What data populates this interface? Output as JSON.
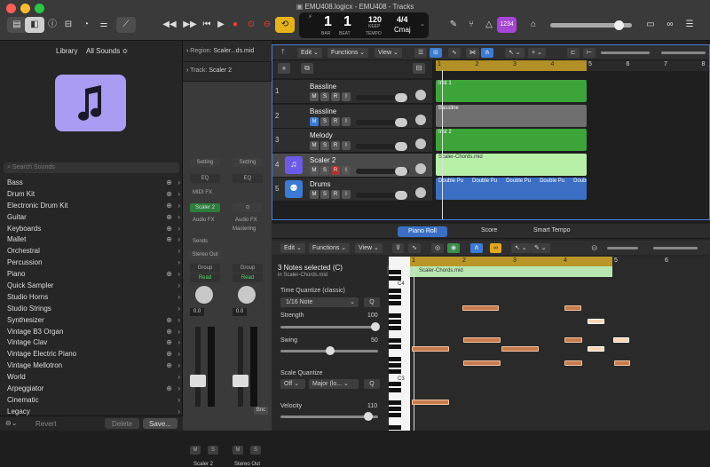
{
  "window": {
    "title": "EMU408.logicx - EMU408 - Tracks"
  },
  "lcd": {
    "bar": "1",
    "beat": "1",
    "bar_label": "BAR",
    "beat_label": "BEAT",
    "tempo": "120",
    "tempo_mode": "KEEP",
    "tempo_label": "TEMPO",
    "time_sig": "4/4",
    "key": "Cmaj"
  },
  "toolbar": {
    "count_in": "1234"
  },
  "library": {
    "title": "Library",
    "filter": "All Sounds ≎",
    "search_placeholder": "Search Sounds",
    "revert": "Revert",
    "delete": "Delete",
    "save": "Save...",
    "items": [
      {
        "label": "Bass",
        "plus": true
      },
      {
        "label": "Drum Kit",
        "plus": true
      },
      {
        "label": "Electronic Drum Kit",
        "plus": true
      },
      {
        "label": "Guitar",
        "plus": true
      },
      {
        "label": "Keyboards",
        "plus": true
      },
      {
        "label": "Mallet",
        "plus": true
      },
      {
        "label": "Orchestral",
        "plus": false
      },
      {
        "label": "Percussion",
        "plus": false
      },
      {
        "label": "Piano",
        "plus": true
      },
      {
        "label": "Quick Sampler",
        "plus": false
      },
      {
        "label": "Studio Horns",
        "plus": false
      },
      {
        "label": "Studio Strings",
        "plus": false
      },
      {
        "label": "Synthesizer",
        "plus": true
      },
      {
        "label": "Vintage B3 Organ",
        "plus": true
      },
      {
        "label": "Vintage Clav",
        "plus": true
      },
      {
        "label": "Vintage Electric Piano",
        "plus": true
      },
      {
        "label": "Vintage Mellotron",
        "plus": true
      },
      {
        "label": "World",
        "plus": false
      },
      {
        "label": "Arpeggiator",
        "plus": true
      },
      {
        "label": "Cinematic",
        "plus": false
      },
      {
        "label": "Legacy",
        "plus": false
      }
    ]
  },
  "inspector": {
    "region": "Region:",
    "region_name": "Scaler...ds.mid",
    "track": "Track:",
    "track_name": "Scaler 2",
    "setting": "Setting",
    "eq": "EQ",
    "midi_fx": "MIDI FX",
    "plugin": "Scaler 2",
    "audio_fx": "Audio FX",
    "audio_fx_mastering": "Mastering",
    "sends": "Sends",
    "stereo_out": "Stereo Out",
    "group": "Group",
    "read": "Read",
    "vol": "0.0",
    "m": "M",
    "s": "S",
    "bnc": "Bnc",
    "strip1": "Scaler 2",
    "strip2": "Stereo Out"
  },
  "tracks_menu": {
    "edit": "Edit",
    "functions": "Functions",
    "view": "View"
  },
  "ruler": [
    "1",
    "2",
    "3",
    "4",
    "5",
    "6",
    "7",
    "8"
  ],
  "tracks": [
    {
      "num": "1",
      "name": "Bassline",
      "region": "Inst 1"
    },
    {
      "num": "2",
      "name": "Bassline",
      "region": "Bassline"
    },
    {
      "num": "3",
      "name": "Melody",
      "region": "Inst 2"
    },
    {
      "num": "4",
      "name": "Scaler 2",
      "region": "Scaler-Chords.mid"
    },
    {
      "num": "5",
      "name": "Drums",
      "region": "Double Pu"
    }
  ],
  "msri": {
    "m": "M",
    "s": "S",
    "r": "R",
    "i": "I"
  },
  "piano_tabs": [
    "Piano Roll",
    "Score",
    "Smart Tempo"
  ],
  "piano": {
    "edit": "Edit",
    "functions": "Functions",
    "view": "View",
    "selection": "3 Notes selected (C)",
    "in_region": "in Scaler-Chords.mid",
    "tq_label": "Time Quantize (classic)",
    "tq_value": "1/16 Note",
    "q": "Q",
    "strength": "Strength",
    "strength_val": "100",
    "swing": "Swing",
    "swing_val": "50",
    "sq_label": "Scale Quantize",
    "sq_off": "Off",
    "sq_mode": "Major (lo...",
    "velocity": "Velocity",
    "velocity_val": "110",
    "region_name": "Scaler-Chords.mid",
    "c4": "C4",
    "c3": "C3",
    "ruler": [
      "1",
      "2",
      "3",
      "4",
      "5",
      "6"
    ]
  }
}
